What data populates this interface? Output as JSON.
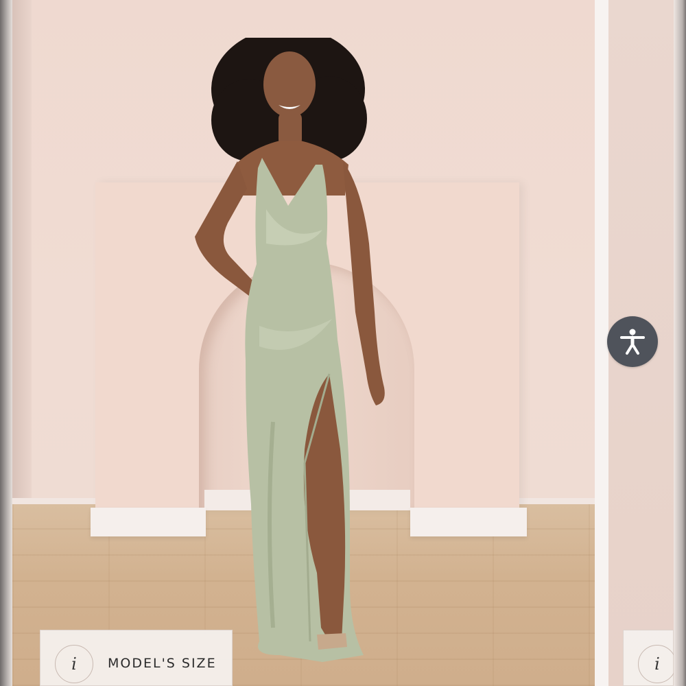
{
  "gallery": {
    "model_size_label": "MODEL'S SIZE",
    "info_glyph": "i",
    "next_info_glyph": "i"
  },
  "accessibility": {
    "icon": "accessibility-person-icon",
    "background": "#4f535b"
  },
  "colors": {
    "dress": "#b7c0a4",
    "wall": "#efd9d0",
    "floor": "#d2b290"
  }
}
